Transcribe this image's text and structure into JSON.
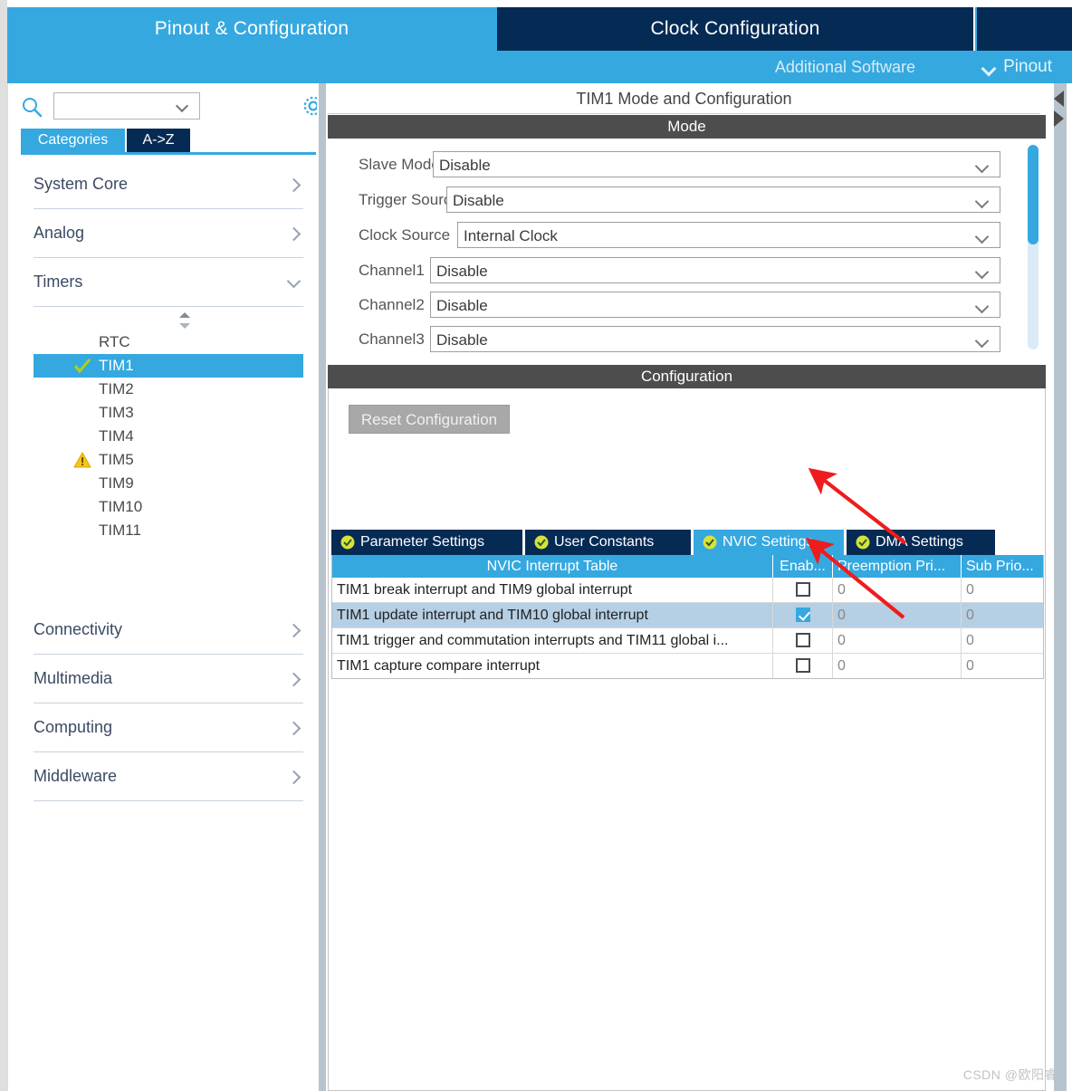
{
  "topbar": {
    "tabs": [
      {
        "label": "Pinout & Configuration",
        "state": "active"
      },
      {
        "label": "Clock Configuration",
        "state": "inactive"
      },
      {
        "label": "",
        "state": "inactive"
      }
    ]
  },
  "subbar": {
    "additional_software": "Additional Software",
    "pinout": "Pinout",
    "pinout_icon": "chevron-down-icon"
  },
  "sidebar": {
    "search": {
      "value": "",
      "placeholder": "",
      "icon": "search-icon"
    },
    "settings_icon": "gear-icon",
    "tabs": [
      {
        "label": "Categories",
        "selected": true
      },
      {
        "label": "A->Z",
        "selected": false
      }
    ],
    "categories": [
      {
        "label": "System Core",
        "expanded": false
      },
      {
        "label": "Analog",
        "expanded": false
      },
      {
        "label": "Timers",
        "expanded": true
      }
    ],
    "peripherals": [
      {
        "label": "RTC",
        "status": "none",
        "selected": false
      },
      {
        "label": "TIM1",
        "status": "check",
        "selected": true
      },
      {
        "label": "TIM2",
        "status": "none",
        "selected": false
      },
      {
        "label": "TIM3",
        "status": "none",
        "selected": false
      },
      {
        "label": "TIM4",
        "status": "none",
        "selected": false
      },
      {
        "label": "TIM5",
        "status": "warning",
        "selected": false
      },
      {
        "label": "TIM9",
        "status": "none",
        "selected": false
      },
      {
        "label": "TIM10",
        "status": "none",
        "selected": false
      },
      {
        "label": "TIM11",
        "status": "none",
        "selected": false
      }
    ],
    "categories_bottom": [
      {
        "label": "Connectivity",
        "expanded": false
      },
      {
        "label": "Multimedia",
        "expanded": false
      },
      {
        "label": "Computing",
        "expanded": false
      },
      {
        "label": "Middleware",
        "expanded": false
      }
    ]
  },
  "main": {
    "panel_title": "TIM1 Mode and Configuration",
    "mode_header": "Mode",
    "config_header": "Configuration",
    "mode_fields": [
      {
        "label": "Slave Mode",
        "value": "Disable"
      },
      {
        "label": "Trigger Source",
        "value": "Disable"
      },
      {
        "label": "Clock Source",
        "value": "Internal Clock"
      },
      {
        "label": "Channel1",
        "value": "Disable"
      },
      {
        "label": "Channel2",
        "value": "Disable"
      },
      {
        "label": "Channel3",
        "value": "Disable"
      }
    ],
    "reset_button": "Reset Configuration",
    "config_tabs": [
      {
        "label": "Parameter Settings",
        "active": false,
        "icon": "check-circle-icon"
      },
      {
        "label": "User Constants",
        "active": false,
        "icon": "check-circle-icon"
      },
      {
        "label": "NVIC Settings",
        "active": true,
        "icon": "check-circle-icon"
      },
      {
        "label": "DMA Settings",
        "active": false,
        "icon": "check-circle-icon"
      }
    ],
    "nvic_table": {
      "columns": [
        "NVIC Interrupt Table",
        "Enab...",
        "Preemption Pri...",
        "Sub Prio..."
      ],
      "rows": [
        {
          "name": "TIM1 break interrupt and TIM9 global interrupt",
          "enabled": false,
          "preemption": "0",
          "sub": "0",
          "selected": false
        },
        {
          "name": "TIM1 update interrupt and TIM10 global interrupt",
          "enabled": true,
          "preemption": "0",
          "sub": "0",
          "selected": true
        },
        {
          "name": "TIM1 trigger and commutation interrupts and TIM11 global i...",
          "enabled": false,
          "preemption": "0",
          "sub": "0",
          "selected": false
        },
        {
          "name": "TIM1 capture compare interrupt",
          "enabled": false,
          "preemption": "0",
          "sub": "0",
          "selected": false
        }
      ]
    }
  },
  "annotations": {
    "arrow_color": "#ee1c1c",
    "arrows": [
      {
        "name": "arrow-to-nvic-tab"
      },
      {
        "name": "arrow-to-enable-checkbox"
      }
    ]
  },
  "watermark": "CSDN @欧阳睿",
  "colors": {
    "accent_light_blue": "#35a8e0",
    "accent_dark_navy": "#052b55",
    "section_header_gray": "#4d4d4d",
    "selected_row_blue": "#b5cfe4",
    "warning_yellow": "#f5c518",
    "ok_green": "#9bc93c"
  }
}
